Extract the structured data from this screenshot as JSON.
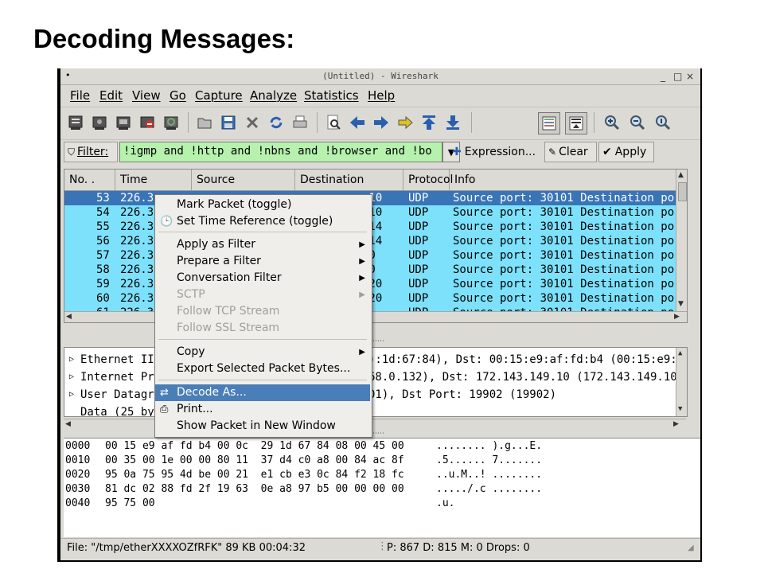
{
  "slide": {
    "title": "Decoding Messages:"
  },
  "window": {
    "title": "(Untitled) - Wireshark",
    "controls": [
      "_",
      "□",
      "×"
    ]
  },
  "menubar": [
    "File",
    "Edit",
    "View",
    "Go",
    "Capture",
    "Analyze",
    "Statistics",
    "Help"
  ],
  "toolbar_icons": [
    "interfaces-icon",
    "capture-options-icon",
    "start-capture-icon",
    "stop-capture-icon",
    "restart-capture-icon",
    "open-file-icon",
    "save-file-icon",
    "close-file-icon",
    "reload-icon",
    "print-icon",
    "find-packet-icon",
    "go-back-icon",
    "go-forward-icon",
    "go-to-packet-icon",
    "go-first-icon",
    "go-last-icon",
    "colorize-icon",
    "autoscroll-icon",
    "zoom-in-icon",
    "zoom-out-icon",
    "zoom-normal-icon"
  ],
  "filter": {
    "label": "Filter:",
    "value": "!igmp and !http and !nbns and !browser and !bo",
    "expression_label": "Expression...",
    "clear_label": "Clear",
    "apply_label": "Apply"
  },
  "packet_list": {
    "columns": [
      "No. .",
      "Time",
      "Source",
      "Destination",
      "Protocol",
      "Info"
    ],
    "rows": [
      {
        "no": "53",
        "time": "226.3",
        "dest": ".10",
        "proto": "UDP",
        "info": "Source port: 30101  Destination por",
        "selected": true
      },
      {
        "no": "54",
        "time": "226.3",
        "dest": ".10",
        "proto": "UDP",
        "info": "Source port: 30101  Destination por",
        "selected": false
      },
      {
        "no": "55",
        "time": "226.3",
        "dest": "114",
        "proto": "UDP",
        "info": "Source port: 30101  Destination por",
        "selected": false
      },
      {
        "no": "56",
        "time": "226.3",
        "dest": "114",
        "proto": "UDP",
        "info": "Source port: 30101  Destination por",
        "selected": false
      },
      {
        "no": "57",
        "time": "226.3",
        "dest": "70",
        "proto": "UDP",
        "info": "Source port: 30101  Destination por",
        "selected": false
      },
      {
        "no": "58",
        "time": "226.3",
        "dest": "70",
        "proto": "UDP",
        "info": "Source port: 30101  Destination por",
        "selected": false
      },
      {
        "no": "59",
        "time": "226.3",
        "dest": "120",
        "proto": "UDP",
        "info": "Source port: 30101  Destination por",
        "selected": false
      },
      {
        "no": "60",
        "time": "226.3",
        "dest": "120",
        "proto": "UDP",
        "info": "Source port: 30101  Destination por",
        "selected": false
      },
      {
        "no": "61",
        "time": "226.3",
        "dest": "",
        "proto": "UDP",
        "info": "Source port: 30101  Destination por",
        "selected": false
      }
    ]
  },
  "detail": {
    "rows": [
      {
        "left": "Ethernet II",
        "right": "):1d:67:84), Dst: 00:15:e9:af:fd:b4 (00:15:e9:af",
        "expander": true
      },
      {
        "left": "Internet Pro",
        "right": "68.0.132), Dst: 172.143.149.10 (172.143.149.10)",
        "expander": true
      },
      {
        "left": "User Datagra",
        "right": "01), Dst Port: 19902 (19902)",
        "expander": true
      },
      {
        "left": "Data (25 by",
        "right": "",
        "expander": false
      }
    ]
  },
  "hex": {
    "rows": [
      {
        "offset": "0000",
        "bytes": "00 15 e9 af fd b4 00 0c  29 1d 67 84 08 00 45 00",
        "ascii": "........ ).g...E."
      },
      {
        "offset": "0010",
        "bytes": "00 35 00 1e 00 00 80 11  37 d4 c0 a8 00 84 ac 8f",
        "ascii": ".5...... 7......."
      },
      {
        "offset": "0020",
        "bytes": "95 0a 75 95 4d be 00 21  e1 cb e3 0c 84 f2 18 fc",
        "ascii": "..u.M..! ........"
      },
      {
        "offset": "0030",
        "bytes": "81 dc 02 88 fd 2f 19 63  0e a8 97 b5 00 00 00 00",
        "ascii": "...../.c ........"
      },
      {
        "offset": "0040",
        "bytes": "95 75 00",
        "ascii": ".u."
      }
    ]
  },
  "status": {
    "file": "File: \"/tmp/etherXXXXOZfRFK\" 89 KB 00:04:32",
    "counts": "P: 867 D: 815 M: 0 Drops: 0"
  },
  "context_menu": {
    "items": [
      {
        "label": "Mark Packet (toggle)",
        "disabled": false,
        "submenu": false,
        "icon": ""
      },
      {
        "label": "Set Time Reference (toggle)",
        "disabled": false,
        "submenu": false,
        "icon": "clock-icon"
      },
      {
        "label": "Apply as Filter",
        "disabled": false,
        "submenu": true,
        "icon": ""
      },
      {
        "label": "Prepare a Filter",
        "disabled": false,
        "submenu": true,
        "icon": ""
      },
      {
        "label": "Conversation Filter",
        "disabled": false,
        "submenu": true,
        "icon": ""
      },
      {
        "label": "SCTP",
        "disabled": true,
        "submenu": true,
        "icon": ""
      },
      {
        "label": "Follow TCP Stream",
        "disabled": true,
        "submenu": false,
        "icon": ""
      },
      {
        "label": "Follow SSL Stream",
        "disabled": true,
        "submenu": false,
        "icon": ""
      },
      {
        "label": "Copy",
        "disabled": false,
        "submenu": true,
        "icon": ""
      },
      {
        "label": "Export Selected Packet Bytes...",
        "disabled": false,
        "submenu": false,
        "icon": ""
      },
      {
        "label": "Decode As...",
        "disabled": false,
        "submenu": false,
        "icon": "decode-icon",
        "highlighted": true
      },
      {
        "label": "Print...",
        "disabled": false,
        "submenu": false,
        "icon": "print-icon"
      },
      {
        "label": "Show Packet in New Window",
        "disabled": false,
        "submenu": false,
        "icon": ""
      }
    ]
  },
  "colors": {
    "row_bg": "#7ee1fb",
    "row_selected": "#3874b6",
    "filter_bg": "#b6f2ad",
    "menu_highlight": "#4a7eb8"
  }
}
